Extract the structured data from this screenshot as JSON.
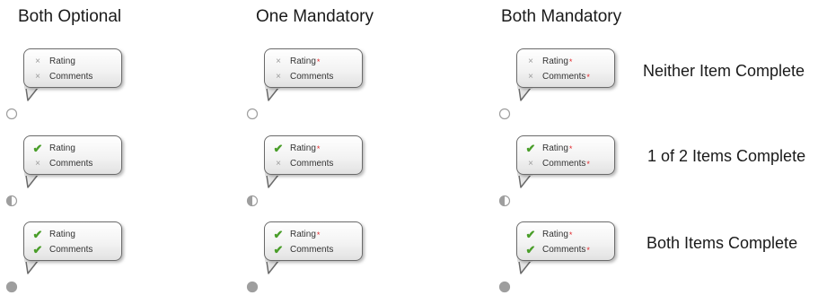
{
  "columns": [
    {
      "header": "Both Optional",
      "rating_required": false,
      "comments_required": false
    },
    {
      "header": "One Mandatory",
      "rating_required": true,
      "comments_required": false
    },
    {
      "header": "Both Mandatory",
      "rating_required": true,
      "comments_required": true
    }
  ],
  "rows": [
    {
      "label": "Neither Item Complete",
      "rating_state": "x",
      "comments_state": "x",
      "status": "empty"
    },
    {
      "label": "1 of 2 Items Complete",
      "rating_state": "check",
      "comments_state": "x",
      "status": "half"
    },
    {
      "label": "Both Items Complete",
      "rating_state": "check",
      "comments_state": "check",
      "status": "full"
    }
  ],
  "items": {
    "rating": "Rating",
    "comments": "Comments"
  },
  "symbols": {
    "x": "×",
    "check": "✔",
    "required": "*"
  },
  "colors": {
    "check": "#4a9e2a",
    "required": "#e0282c",
    "x": "#9a9a9a",
    "status": "#9e9e9e"
  },
  "icons": {
    "x": "x-icon",
    "check": "checkmark-icon"
  }
}
